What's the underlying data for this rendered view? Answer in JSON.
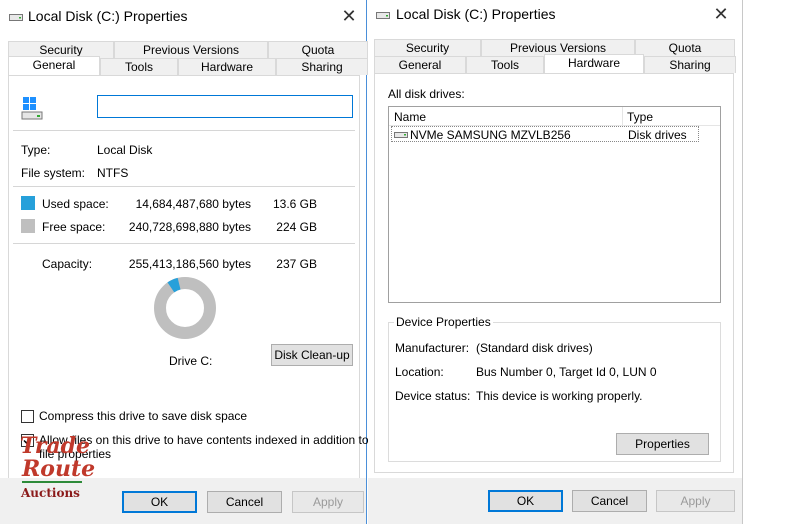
{
  "left_window": {
    "title": "Local Disk (C:) Properties",
    "tabs_back": [
      "Security",
      "Previous Versions",
      "Quota"
    ],
    "tabs_front": [
      "General",
      "Tools",
      "Hardware",
      "Sharing"
    ],
    "active_tab": "General",
    "name_input_value": "",
    "type_label": "Type:",
    "type_value": "Local Disk",
    "fs_label": "File system:",
    "fs_value": "NTFS",
    "used_label": "Used space:",
    "used_bytes": "14,684,487,680 bytes",
    "used_gb": "13.6 GB",
    "free_label": "Free space:",
    "free_bytes": "240,728,698,880 bytes",
    "free_gb": "224 GB",
    "capacity_label": "Capacity:",
    "capacity_bytes": "255,413,186,560 bytes",
    "capacity_gb": "237 GB",
    "used_fraction": 0.0575,
    "used_color": "#26a0da",
    "free_color": "#bfbfbf",
    "drive_label": "Drive C:",
    "cleanup_button": "Disk Clean-up",
    "compress_label": "Compress this drive to save disk space",
    "compress_checked": false,
    "index_label_line1": "Allow files on this drive to have contents indexed in addition to",
    "index_label_line2": "file properties",
    "index_checked": true,
    "ok": "OK",
    "cancel": "Cancel",
    "apply": "Apply"
  },
  "right_window": {
    "title": "Local Disk (C:) Properties",
    "tabs_back": [
      "Security",
      "Previous Versions",
      "Quota"
    ],
    "tabs_front": [
      "General",
      "Tools",
      "Hardware",
      "Sharing"
    ],
    "active_tab": "Hardware",
    "all_drives_label": "All disk drives:",
    "col_name": "Name",
    "col_type": "Type",
    "drives": [
      {
        "name": "NVMe SAMSUNG MZVLB256",
        "type": "Disk drives"
      }
    ],
    "device_props_title": "Device Properties",
    "manufacturer_label": "Manufacturer:",
    "manufacturer_value": "(Standard disk drives)",
    "location_label": "Location:",
    "location_value": "Bus Number 0, Target Id 0, LUN 0",
    "status_label": "Device status:",
    "status_value": "This device is working properly.",
    "properties_button": "Properties",
    "ok": "OK",
    "cancel": "Cancel",
    "apply": "Apply"
  },
  "watermark": {
    "line1": "Trade",
    "line2": "Route",
    "line3": "Auctions",
    "color_main": "#c0392b",
    "color_accent": "#2e8b3a"
  }
}
